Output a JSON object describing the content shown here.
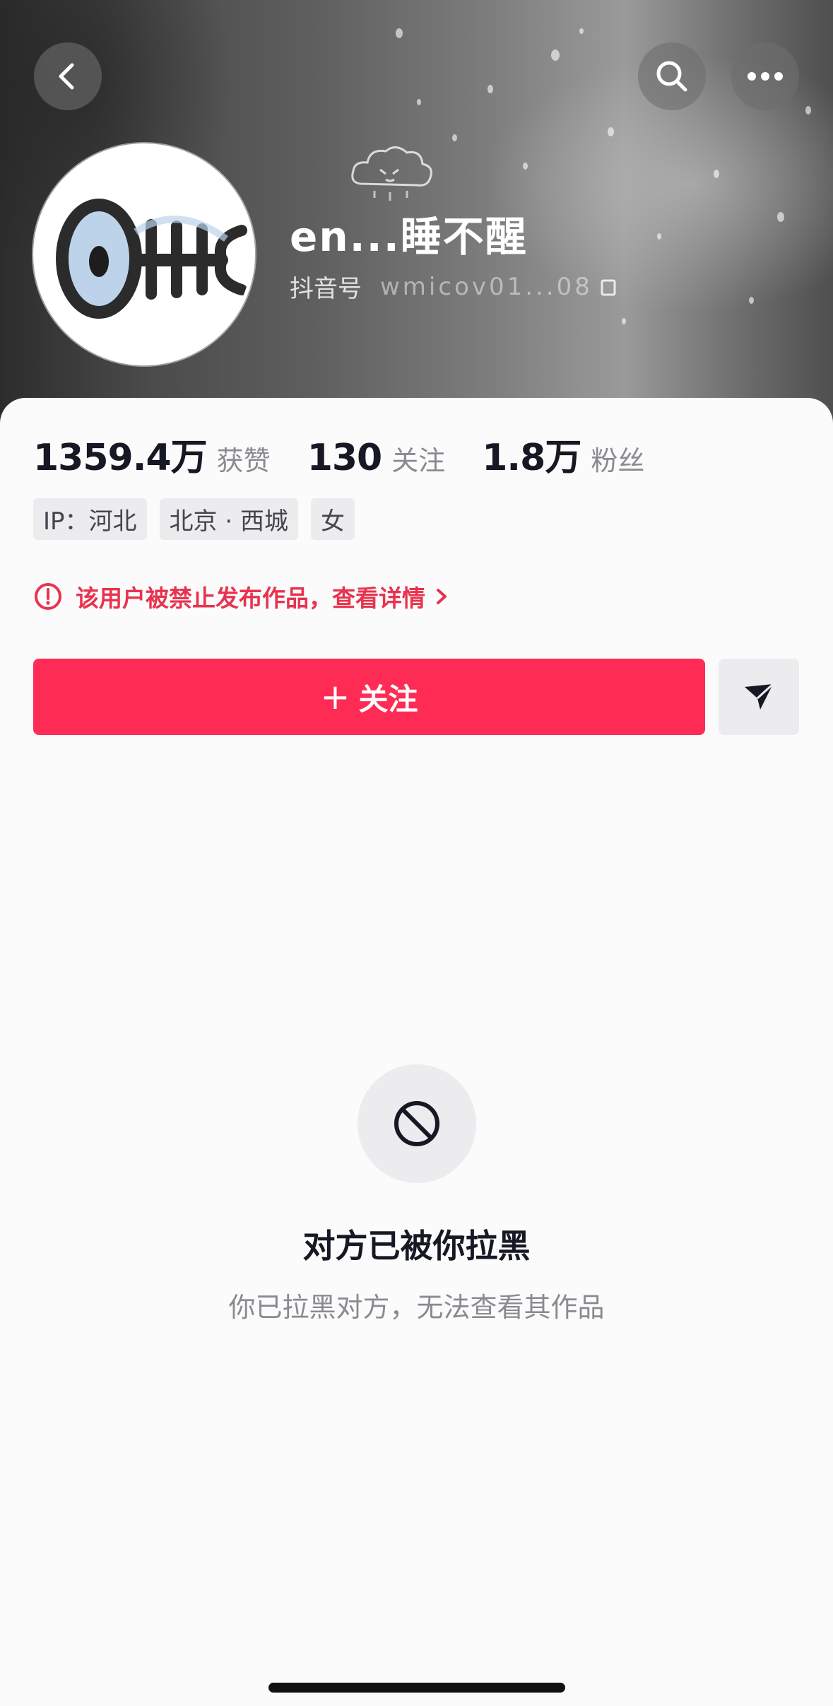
{
  "header": {
    "back_icon": "chevron-left-icon",
    "search_icon": "search-icon",
    "more_icon": "ellipsis-icon"
  },
  "profile": {
    "nickname": "en...睡不醒",
    "id_label": "抖音号",
    "id_value": "wmicov01...08"
  },
  "stats": [
    {
      "value": "1359.4万",
      "label": "获赞"
    },
    {
      "value": "130",
      "label": "关注"
    },
    {
      "value": "1.8万",
      "label": "粉丝"
    }
  ],
  "tags": [
    "IP：河北",
    "北京 · 西城",
    "女"
  ],
  "notice": {
    "text": "该用户被禁止发布作品，查看详情",
    "color": "#e8334f"
  },
  "actions": {
    "follow_plus": "+",
    "follow_label": "关注",
    "follow_color": "#fe2c55",
    "message_icon": "send-icon"
  },
  "empty_state": {
    "icon": "block-icon",
    "title": "对方已被你拉黑",
    "subtitle": "你已拉黑对方，无法查看其作品"
  }
}
